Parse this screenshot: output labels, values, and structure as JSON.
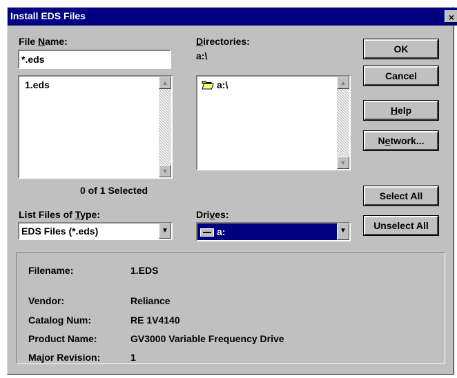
{
  "window": {
    "title": "Install EDS Files",
    "close_glyph": "×"
  },
  "file_name": {
    "label_pre": "File ",
    "label_key": "N",
    "label_post": "ame:",
    "value": "*.eds"
  },
  "file_list": {
    "items": [
      "1.eds"
    ],
    "selection_status": "0 of 1 Selected"
  },
  "directories": {
    "label_key": "D",
    "label_post": "irectories:",
    "current_path": "a:\\",
    "items": [
      "a:\\"
    ]
  },
  "file_type": {
    "label_pre": "List Files of ",
    "label_key": "T",
    "label_post": "ype:",
    "value": "EDS Files (*.eds)"
  },
  "drives": {
    "label_pre": "Dri",
    "label_key": "v",
    "label_post": "es:",
    "value": "a:"
  },
  "buttons": {
    "ok": "OK",
    "cancel": "Cancel",
    "help_key": "H",
    "help_post": "elp",
    "network_pre": "N",
    "network_key": "e",
    "network_post": "twork...",
    "select_all": "Select All",
    "unselect_all": "Unselect All"
  },
  "details": {
    "filename_label": "Filename:",
    "filename_value": "1.EDS",
    "vendor_label": "Vendor:",
    "vendor_value": "Reliance",
    "catalog_label": "Catalog Num:",
    "catalog_value": "RE 1V4140",
    "product_label": "Product Name:",
    "product_value": "GV3000 Variable Frequency Drive",
    "revision_label": "Major Revision:",
    "revision_value": "1"
  },
  "colors": {
    "titlebar": "#000080",
    "face": "#c0c0c0",
    "selection": "#000080"
  }
}
